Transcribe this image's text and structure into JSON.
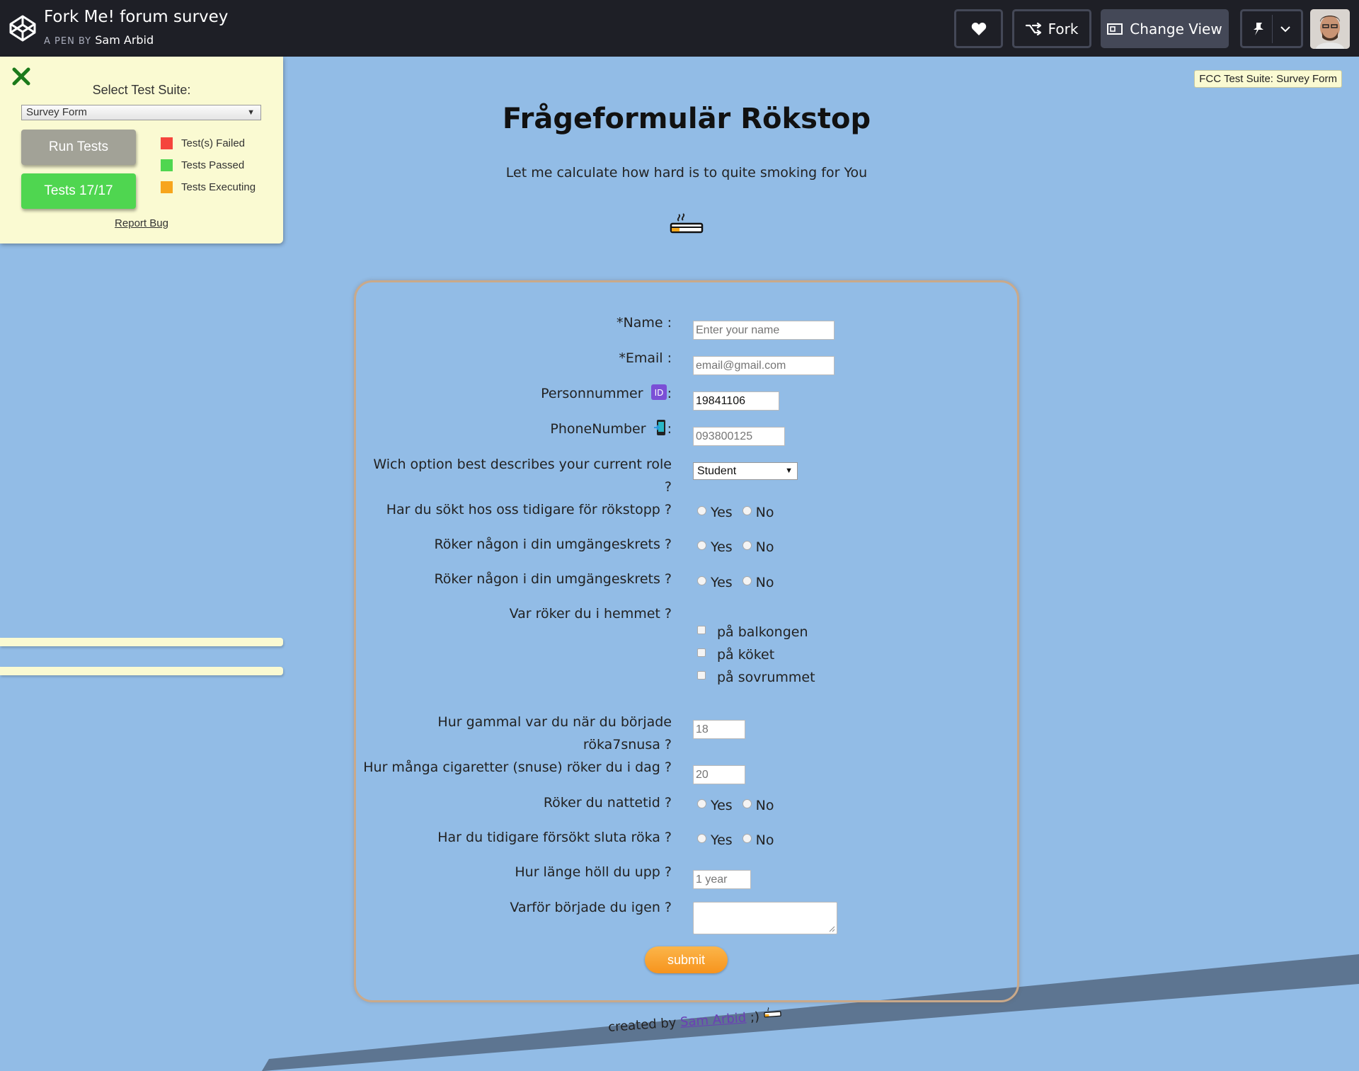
{
  "header": {
    "pen_title": "Fork Me! forum survey",
    "pen_by": "A PEN BY",
    "author": "Sam Arbid",
    "like_icon": "heart-icon",
    "fork_label": "Fork",
    "change_view_label": "Change View",
    "pin_icon": "pin-icon"
  },
  "fcc": {
    "select_label": "Select Test Suite:",
    "selected_suite": "Survey Form",
    "run_tests_label": "Run Tests",
    "tests_label": "Tests 17/17",
    "legend": [
      {
        "label": "Test(s) Failed",
        "color": "#f5453c"
      },
      {
        "label": "Tests Passed",
        "color": "#4fd650"
      },
      {
        "label": "Tests Executing",
        "color": "#f7a51c"
      }
    ],
    "report_bug": "Report Bug",
    "suite_tag": "FCC Test Suite: Survey Form"
  },
  "page": {
    "title": "Frågeformulär Rökstop",
    "description": "Let me calculate how hard is to quite smoking for You"
  },
  "form": {
    "name_label": "*Name :",
    "name_placeholder": "Enter your name",
    "email_label": "*Email :",
    "email_placeholder": "email@gmail.com",
    "personnummer_label": "Personnummer",
    "personnummer_value": "19841106",
    "phone_label": "PhoneNumber",
    "phone_placeholder": "093800125",
    "role_label_line1": "Wich option best describes your current role",
    "role_label_line2": "?",
    "role_value": "Student",
    "q_previous_visit": "Har du sökt hos oss tidigare för rökstopp ?",
    "q_circle_smokes_1": "Röker någon i din umgängeskrets ?",
    "q_circle_smokes_2": "Röker någon i din umgängeskrets ?",
    "q_where_home": "Var röker du i hemmet ?",
    "checkbox_options": [
      "på balkongen",
      "på köket",
      "på sovrummet"
    ],
    "q_age_start_line1": "Hur gammal var du när du började",
    "q_age_start_line2": "röka7snusa ?",
    "age_placeholder": "18",
    "q_cigs_per_day": "Hur många cigaretter (snuse) röker du i dag ?",
    "cigs_placeholder": "20",
    "q_night_smoking": "Röker du nattetid ?",
    "q_tried_quit": "Har du tidigare försökt sluta röka ?",
    "q_how_long": "Hur länge höll du upp ?",
    "how_long_placeholder": "1 year",
    "q_why_restart": "Varför började du igen ?",
    "yes": "Yes",
    "no": "No",
    "submit_label": "submit",
    "colon": ":"
  },
  "footer": {
    "created_by": "created by",
    "author_link": "Sam Arbid",
    "suffix": ";)"
  },
  "colors": {
    "background": "#92bce6",
    "topbar": "#1e1f26",
    "panel": "#fafad2",
    "submit": "#f7941d",
    "footer_band": "#5d7591"
  }
}
